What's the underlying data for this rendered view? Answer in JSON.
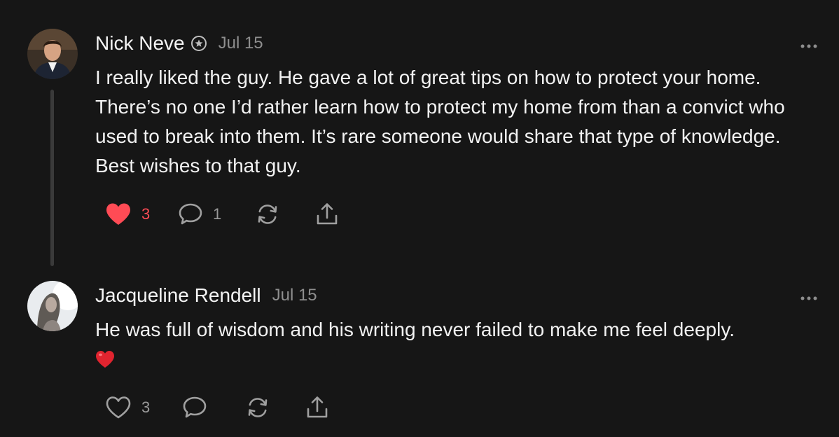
{
  "comments": [
    {
      "author": "Nick Neve",
      "date": "Jul 15",
      "text": "I really liked the guy. He gave a lot of great tips on how to protect your home. There’s no one I’d rather learn how to protect my home from than a convict who used to break into them. It’s rare someone would share that type of knowledge. Best wishes to that guy.",
      "likes": "3",
      "replies": "1",
      "liked": true
    },
    {
      "author": "Jacqueline Rendell",
      "date": "Jul 15",
      "text": "He was full of wisdom and his writing never failed to make me feel deeply.",
      "emoji": "heart",
      "likes": "3",
      "liked": false
    }
  ],
  "icons": {
    "badge": "verified-badge-icon",
    "more": "more-options-icon",
    "like": "heart-icon",
    "reply": "comment-icon",
    "restack": "restack-icon",
    "share": "share-icon"
  },
  "colors": {
    "background": "#161616",
    "liked": "#ff4b55",
    "muted": "#8e8e8e"
  }
}
